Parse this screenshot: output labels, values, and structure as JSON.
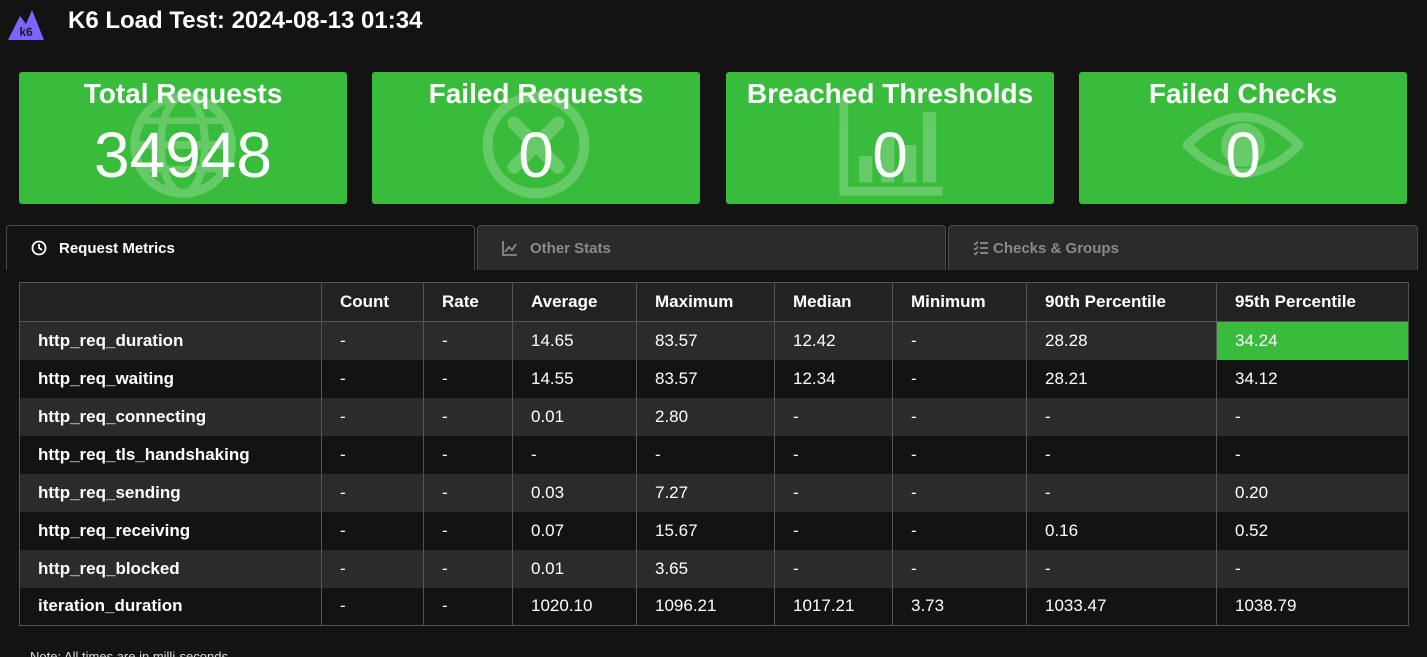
{
  "header": {
    "logo_text": "k6",
    "title": "K6 Load Test: 2024-08-13 01:34"
  },
  "colors": {
    "accent": "#39bb3c",
    "logo": "#7d64ff",
    "background": "#131313"
  },
  "cards": [
    {
      "title": "Total Requests",
      "value": "34948",
      "icon": "globe-icon"
    },
    {
      "title": "Failed Requests",
      "value": "0",
      "icon": "x-circle-icon"
    },
    {
      "title": "Breached Thresholds",
      "value": "0",
      "icon": "bar-chart-icon"
    },
    {
      "title": "Failed Checks",
      "value": "0",
      "icon": "eye-icon"
    }
  ],
  "tabs": [
    {
      "label": "Request Metrics",
      "icon": "clock-icon",
      "active": true
    },
    {
      "label": "Other Stats",
      "icon": "line-chart-icon",
      "active": false
    },
    {
      "label": "Checks & Groups",
      "icon": "checklist-icon",
      "active": false
    }
  ],
  "table": {
    "headers": [
      "",
      "Count",
      "Rate",
      "Average",
      "Maximum",
      "Median",
      "Minimum",
      "90th Percentile",
      "95th Percentile"
    ],
    "rows": [
      [
        "http_req_duration",
        "-",
        "-",
        "14.65",
        "83.57",
        "12.42",
        "-",
        "28.28",
        "34.24"
      ],
      [
        "http_req_waiting",
        "-",
        "-",
        "14.55",
        "83.57",
        "12.34",
        "-",
        "28.21",
        "34.12"
      ],
      [
        "http_req_connecting",
        "-",
        "-",
        "0.01",
        "2.80",
        "-",
        "-",
        "-",
        "-"
      ],
      [
        "http_req_tls_handshaking",
        "-",
        "-",
        "-",
        "-",
        "-",
        "-",
        "-",
        "-"
      ],
      [
        "http_req_sending",
        "-",
        "-",
        "0.03",
        "7.27",
        "-",
        "-",
        "-",
        "0.20"
      ],
      [
        "http_req_receiving",
        "-",
        "-",
        "0.07",
        "15.67",
        "-",
        "-",
        "0.16",
        "0.52"
      ],
      [
        "http_req_blocked",
        "-",
        "-",
        "0.01",
        "3.65",
        "-",
        "-",
        "-",
        "-"
      ],
      [
        "iteration_duration",
        "-",
        "-",
        "1020.10",
        "1096.21",
        "1017.21",
        "3.73",
        "1033.47",
        "1038.79"
      ]
    ],
    "highlighted_cell": {
      "row": 0,
      "col": 8
    }
  },
  "note": "Note: All times are in milli-seconds"
}
